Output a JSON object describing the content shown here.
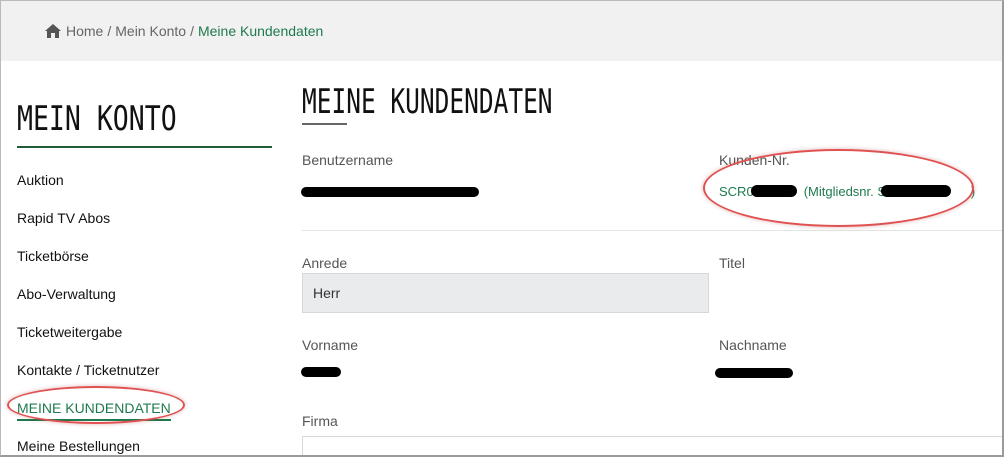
{
  "breadcrumb": {
    "items": [
      "Home",
      "Mein Konto",
      "Meine Kundendaten"
    ],
    "separator": "/"
  },
  "sidebar": {
    "title": "MEIN KONTO",
    "items": [
      {
        "label": "Auktion"
      },
      {
        "label": "Rapid TV Abos"
      },
      {
        "label": "Ticketbörse"
      },
      {
        "label": "Abo-Verwaltung"
      },
      {
        "label": "Ticketweitergabe"
      },
      {
        "label": "Kontakte / Ticketnutzer"
      },
      {
        "label": "MEINE KUNDENDATEN"
      },
      {
        "label": "Meine Bestellungen"
      }
    ],
    "active_index": 6
  },
  "main": {
    "title": "MEINE KUNDENDATEN",
    "fields": {
      "benutzername_label": "Benutzername",
      "kunden_nr_label": "Kunden-Nr.",
      "kunden_nr_prefix": "SCR0",
      "mitglieds_text": "(Mitgliedsnr. SCR",
      "mitglieds_suffix": ")",
      "anrede_label": "Anrede",
      "anrede_value": "Herr",
      "titel_label": "Titel",
      "vorname_label": "Vorname",
      "nachname_label": "Nachname",
      "firma_label": "Firma"
    }
  },
  "colors": {
    "accent": "#1e7a4e",
    "annotation": "#e05252"
  },
  "icons": {
    "home": "home-icon"
  }
}
